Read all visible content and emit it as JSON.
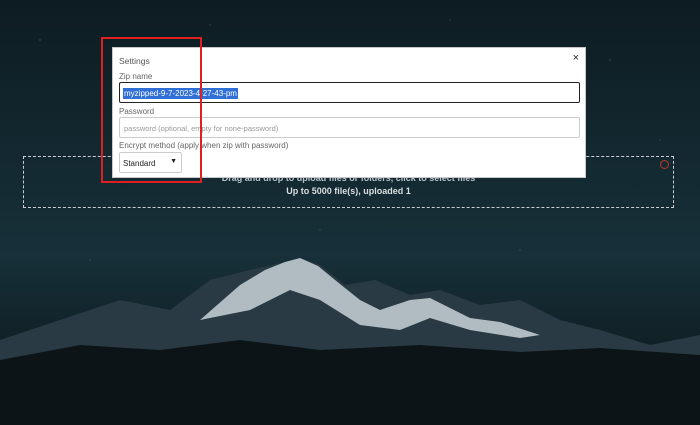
{
  "dropzone": {
    "line1": "Drag and drop to upload files or folders, click to select files",
    "line2": "Up to 5000 file(s), uploaded 1"
  },
  "dialog": {
    "title": "Settings",
    "close_glyph": "×",
    "zip_name_label": "Zip name",
    "zip_name_value": "myzipped-9-7-2023-4-27-43-pm",
    "password_label": "Password",
    "password_placeholder": "password (optional, empty for none-password)",
    "encrypt_label": "Encrypt method (apply when zip with password)",
    "encrypt_selected": "Standard"
  },
  "icons": {
    "dialog_close": "close-icon",
    "dropzone_close": "remove-icon",
    "select_chevron": "chevron-down-icon"
  },
  "colors": {
    "selection": "#2f6fd6",
    "highlight": "#e02020",
    "background": "#0b1418"
  }
}
